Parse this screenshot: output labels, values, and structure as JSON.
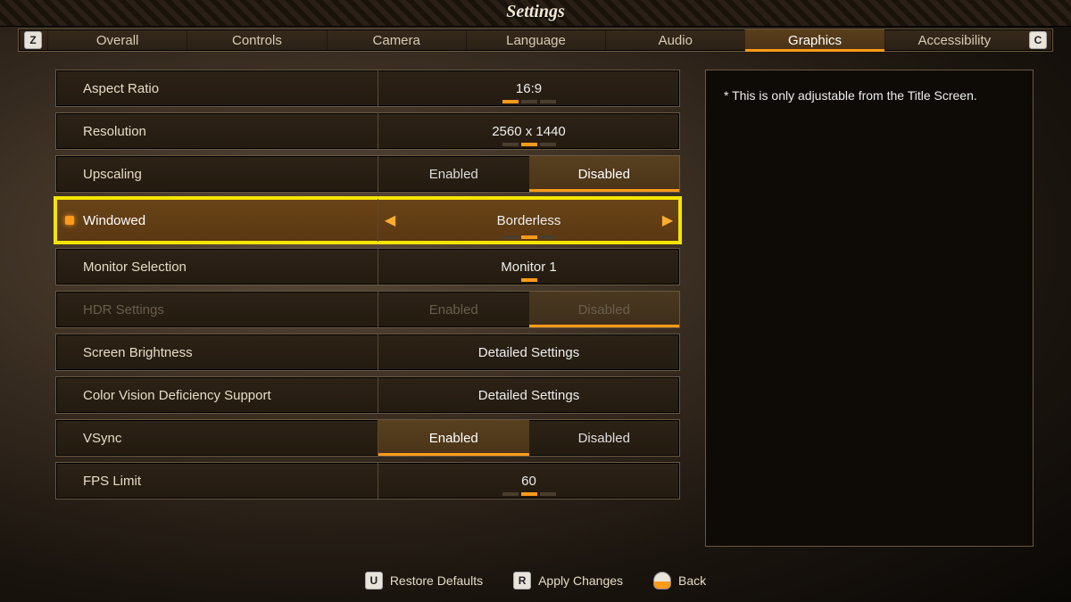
{
  "title": "Settings",
  "keys": {
    "left": "Z",
    "right": "C",
    "restore": "U",
    "apply": "R"
  },
  "tabs": [
    "Overall",
    "Controls",
    "Camera",
    "Language",
    "Audio",
    "Graphics",
    "Accessibility"
  ],
  "active_tab_index": 5,
  "side_note": "* This is only adjustable from the Title Screen.",
  "footer": {
    "restore": "Restore Defaults",
    "apply": "Apply Changes",
    "back": "Back"
  },
  "rows": {
    "aspect": {
      "label": "Aspect Ratio",
      "value": "16:9",
      "ticks": 3,
      "tick_on": 0
    },
    "res": {
      "label": "Resolution",
      "value": "2560 x 1440",
      "ticks": 3,
      "tick_on": 1
    },
    "upscale": {
      "label": "Upscaling",
      "left": "Enabled",
      "right": "Disabled",
      "selected": "right"
    },
    "windowed": {
      "label": "Windowed",
      "value": "Borderless",
      "ticks": 3,
      "tick_on": 1
    },
    "monitor": {
      "label": "Monitor Selection",
      "value": "Monitor 1",
      "ticks": 1,
      "tick_on": 0
    },
    "hdr": {
      "label": "HDR Settings",
      "left": "Enabled",
      "right": "Disabled",
      "selected": "right"
    },
    "bright": {
      "label": "Screen Brightness",
      "value": "Detailed Settings"
    },
    "cvd": {
      "label": "Color Vision Deficiency Support",
      "value": "Detailed Settings"
    },
    "vsync": {
      "label": "VSync",
      "left": "Enabled",
      "right": "Disabled",
      "selected": "left"
    },
    "fps": {
      "label": "FPS Limit",
      "value": "60",
      "ticks": 3,
      "tick_on": 1
    }
  }
}
